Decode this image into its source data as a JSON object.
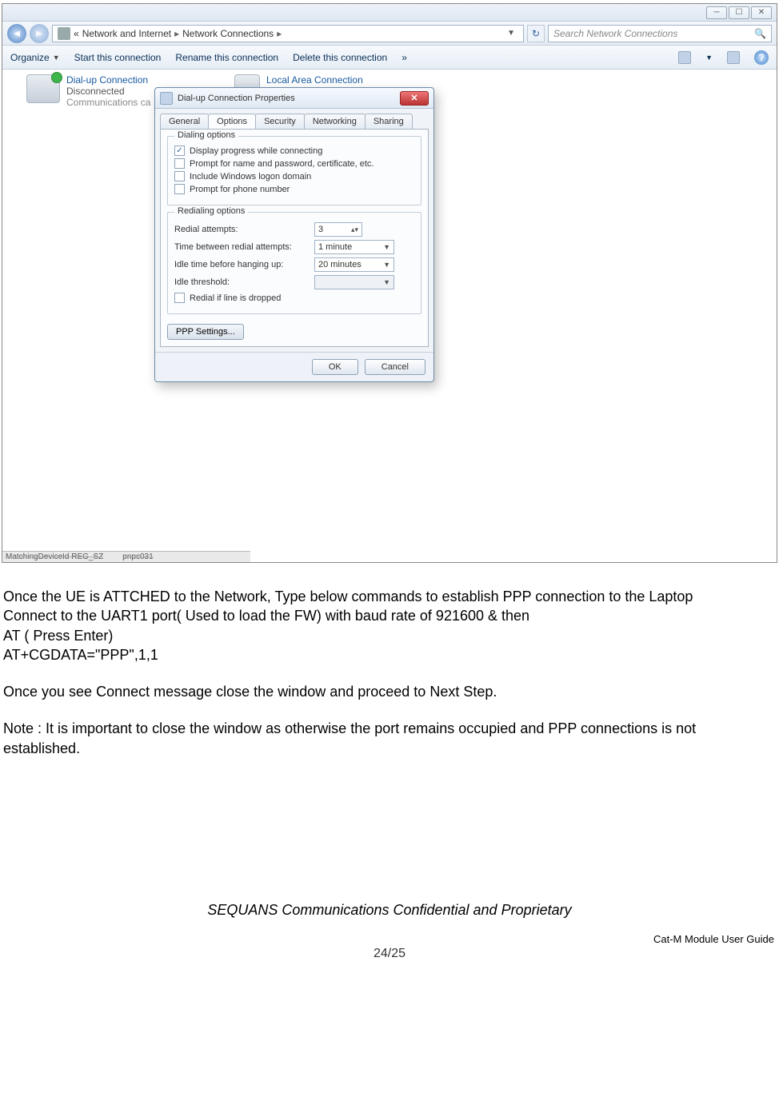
{
  "screenshot": {
    "window_buttons": [
      "─",
      "☐",
      "✕"
    ],
    "breadcrumb": {
      "chevrons": "«",
      "path1": "Network and Internet",
      "path2": "Network Connections",
      "sep": "▸"
    },
    "search_placeholder": "Search Network Connections",
    "toolbar": {
      "organize": "Organize",
      "start": "Start this connection",
      "rename": "Rename this connection",
      "delete": "Delete this connection",
      "more": "»"
    },
    "connections": {
      "dialup": {
        "name": "Dial-up Connection",
        "status": "Disconnected",
        "device": "Communications ca"
      },
      "lan": {
        "name": "Local Area Connection"
      }
    },
    "dialog": {
      "title": "Dial-up Connection Properties",
      "tabs": [
        "General",
        "Options",
        "Security",
        "Networking",
        "Sharing"
      ],
      "active_tab": "Options",
      "dialing": {
        "legend": "Dialing options",
        "chk1": "Display progress while connecting",
        "chk2": "Prompt for name and password, certificate, etc.",
        "chk3": "Include Windows logon domain",
        "chk4": "Prompt for phone number"
      },
      "redialing": {
        "legend": "Redialing options",
        "attempts_lbl": "Redial attempts:",
        "attempts_val": "3",
        "between_lbl": "Time between redial attempts:",
        "between_val": "1 minute",
        "idle_lbl": "Idle time before hanging up:",
        "idle_val": "20 minutes",
        "threshold_lbl": "Idle threshold:",
        "threshold_val": "",
        "line_dropped": "Redial if line is dropped"
      },
      "ppp_button": "PPP Settings...",
      "ok": "OK",
      "cancel": "Cancel"
    },
    "regstrip": {
      "a": "MatchingDeviceId  REG_SZ",
      "b": "pnpc031"
    }
  },
  "doc": {
    "p1": "Once the UE is ATTCHED to the Network, Type below commands to establish PPP connection to the Laptop",
    "p2": "Connect to the UART1 port( Used to load the FW) with baud rate of 921600 & then",
    "p3": "AT ( Press Enter)",
    "p4": "AT+CGDATA=\"PPP\",1,1",
    "p5": "Once you see Connect message close the window and proceed to Next Step.",
    "p6": "Note : It is important to close the window as otherwise the port remains occupied and PPP connections is not established."
  },
  "footer": {
    "conf": "SEQUANS Communications Confidential and Proprietary",
    "guide": "Cat-M Module User Guide",
    "page": "24/25"
  }
}
